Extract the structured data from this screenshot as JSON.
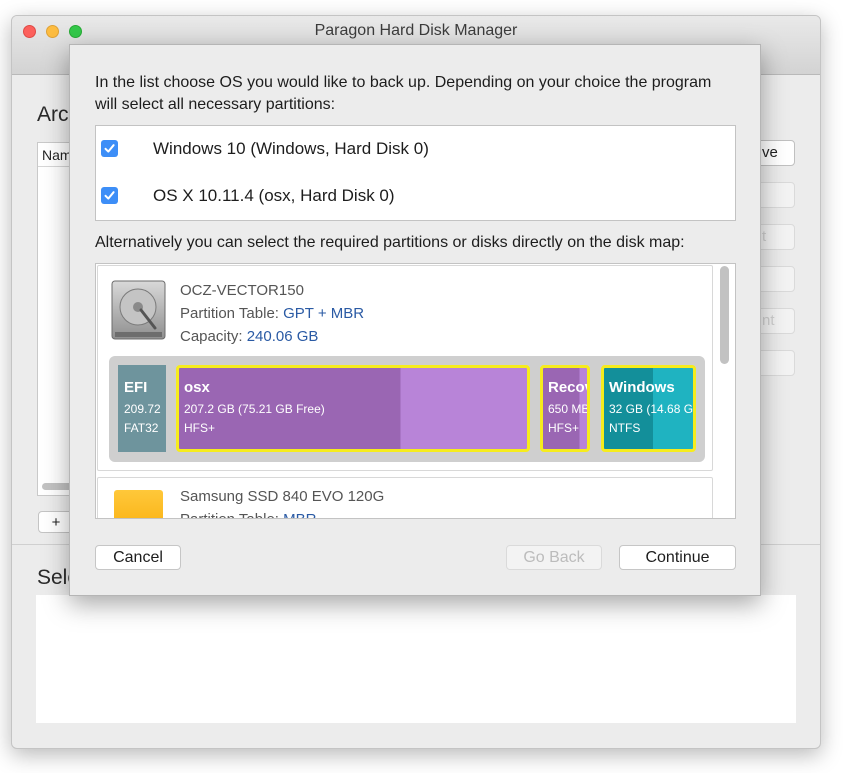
{
  "window": {
    "title": "Paragon Hard Disk Manager",
    "archives_heading": "Arc",
    "archives_column": "Nam",
    "add_label": "+",
    "select_heading": "Sele",
    "side_buttons": [
      "ve",
      "",
      "t",
      "",
      "nt",
      ""
    ]
  },
  "dialog": {
    "instruction": "In the list choose OS you would like to back up. Depending on your choice the program will select all necessary partitions:",
    "os_list": [
      {
        "label": "Windows 10 (Windows, Hard Disk 0)",
        "checked": true
      },
      {
        "label": "OS X 10.11.4 (osx, Hard Disk 0)",
        "checked": true
      }
    ],
    "alt_text": "Alternatively you can select the required partitions or disks directly on the disk map:",
    "disks": [
      {
        "name": "OCZ-VECTOR150",
        "partition_label": "Partition Table:",
        "partition_value": "GPT + MBR",
        "capacity_label": "Capacity:",
        "capacity_value": "240.06 GB",
        "partitions": [
          {
            "name": "EFI",
            "size": "209.72",
            "fs": "FAT32",
            "selected": false,
            "color": "#6e949d",
            "used_fraction": 1.0
          },
          {
            "name": "osx",
            "size": "207.2 GB (75.21 GB Free)",
            "fs": "HFS+",
            "selected": true,
            "color": "#9a66b3",
            "free_color": "#b884d8",
            "used_fraction": 0.637
          },
          {
            "name": "Recov",
            "size": "650 MB",
            "fs": "HFS+",
            "selected": true,
            "color": "#9a66b3",
            "free_color": "#b884d8",
            "used_fraction": 0.83
          },
          {
            "name": "Windows",
            "size": "32 GB (14.68 G",
            "fs": "NTFS",
            "selected": true,
            "color": "#138f9a",
            "free_color": "#1fb3c1",
            "used_fraction": 0.55
          }
        ]
      },
      {
        "name": "Samsung SSD 840 EVO 120G",
        "partition_label": "Partition Table:",
        "partition_value": "MBR"
      }
    ],
    "buttons": {
      "cancel": "Cancel",
      "back": "Go Back",
      "continue": "Continue"
    }
  },
  "colors": {
    "checkbox": "#3d8ef7",
    "selection_border": "#f6ec1d",
    "link_value": "#2a5aa4"
  }
}
